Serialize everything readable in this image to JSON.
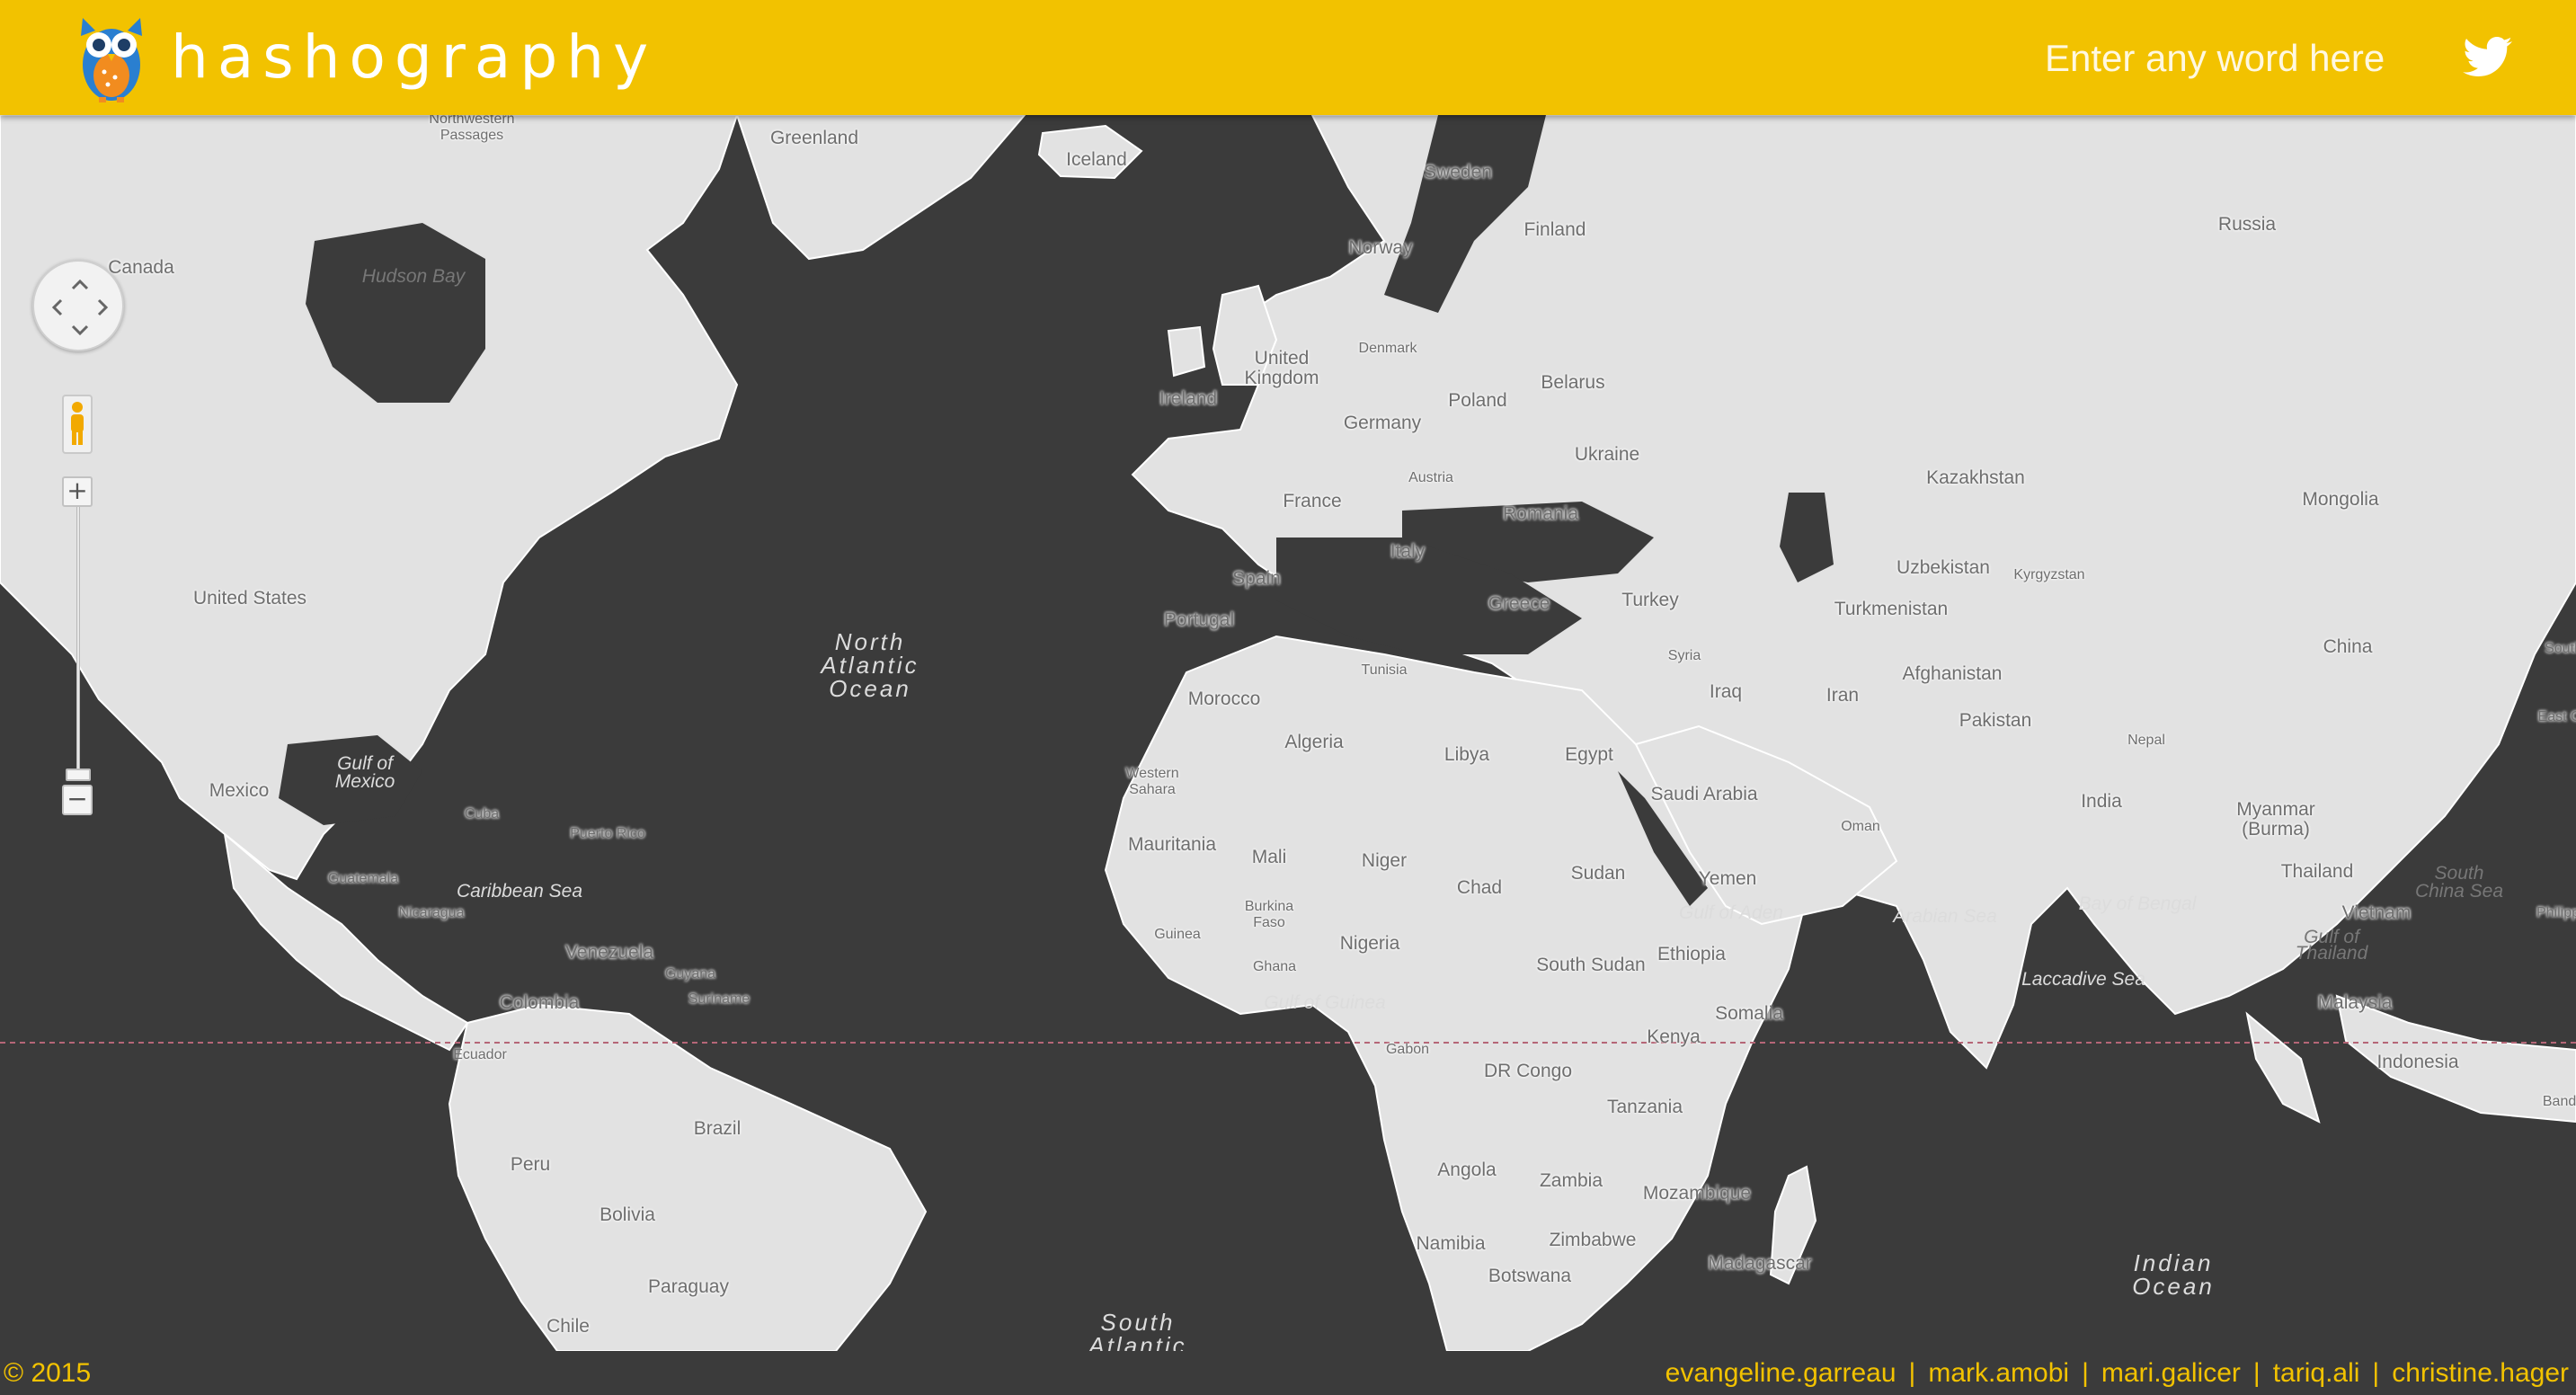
{
  "header": {
    "brand": "hashography",
    "search_placeholder": "Enter any word here",
    "logo_icon": "owl-icon",
    "share_icon": "twitter-icon",
    "brand_color": "#f2c200"
  },
  "map": {
    "controls": {
      "pan_icon": "pan-arrows-icon",
      "pegman_icon": "street-view-pegman-icon",
      "zoom_in": "+",
      "zoom_out": "−"
    },
    "labels": {
      "northwestern_passages": "Northwestern\nPassages",
      "greenland": "Greenland",
      "iceland": "Iceland",
      "sweden": "Sweden",
      "finland": "Finland",
      "norway": "Norway",
      "russia": "Russia",
      "canada": "Canada",
      "hudson_bay": "Hudson Bay",
      "united_kingdom": "United\nKingdom",
      "denmark": "Denmark",
      "ireland": "Ireland",
      "poland": "Poland",
      "belarus": "Belarus",
      "germany": "Germany",
      "ukraine": "Ukraine",
      "kazakhstan": "Kazakhstan",
      "mongolia": "Mongolia",
      "france": "France",
      "austria": "Austria",
      "romania": "Romania",
      "italy": "Italy",
      "united_states": "United States",
      "spain": "Spain",
      "portugal": "Portugal",
      "uzbekistan": "Uzbekistan",
      "kyrgyzstan": "Kyrgyzstan",
      "turkey": "Turkey",
      "greece": "Greece",
      "turkmenistan": "Turkmenistan",
      "north_atlantic_ocean": "North\nAtlantic\nOcean",
      "syria": "Syria",
      "china": "China",
      "tunisia": "Tunisia",
      "afghanistan": "Afghanistan",
      "iraq": "Iraq",
      "iran": "Iran",
      "morocco": "Morocco",
      "pakistan": "Pakistan",
      "gulf_of_mexico": "Gulf of\nMexico",
      "algeria": "Algeria",
      "libya": "Libya",
      "egypt": "Egypt",
      "nepal": "Nepal",
      "western_sahara": "Western\nSahara",
      "mexico": "Mexico",
      "saudi_arabia": "Saudi Arabia",
      "india": "India",
      "cuba": "Cuba",
      "puerto_rico": "Puerto Rico",
      "myanmar": "Myanmar\n(Burma)",
      "oman": "Oman",
      "mauritania": "Mauritania",
      "mali": "Mali",
      "niger": "Niger",
      "sudan": "Sudan",
      "guatemala": "Guatemala",
      "yemen": "Yemen",
      "chad": "Chad",
      "caribbean_sea": "Caribbean Sea",
      "thailand": "Thailand",
      "south_china_sea": "South\nChina Sea",
      "bay_of_bengal": "Bay of Bengal",
      "burkina_faso": "Burkina\nFaso",
      "gulf_of_aden": "Gulf of Aden",
      "arabian_sea": "Arabian Sea",
      "nicaragua": "Nicaragua",
      "vietnam": "Vietnam",
      "venezuela": "Venezuela",
      "guinea": "Guinea",
      "nigeria": "Nigeria",
      "ethiopia": "Ethiopia",
      "gulf_of_thailand": "Gulf of\nThailand",
      "guyana": "Guyana",
      "ghana": "Ghana",
      "south_sudan": "South Sudan",
      "suriname": "Suriname",
      "laccadive_sea": "Laccadive Sea",
      "colombia": "Colombia",
      "gulf_of_guinea": "Gulf of Guinea",
      "somalia": "Somalia",
      "malaysia": "Malaysia",
      "ecuador": "Ecuador",
      "gabon": "Gabon",
      "kenya": "Kenya",
      "indonesia": "Indonesia",
      "dr_congo": "DR Congo",
      "tanzania": "Tanzania",
      "brazil": "Brazil",
      "peru": "Peru",
      "angola": "Angola",
      "zambia": "Zambia",
      "mozambique": "Mozambique",
      "bolivia": "Bolivia",
      "zimbabwe": "Zimbabwe",
      "namibia": "Namibia",
      "madagascar": "Madagascar",
      "indian_ocean": "Indian\nOcean",
      "botswana": "Botswana",
      "paraguay": "Paraguay",
      "chile": "Chile",
      "south_atlantic": "South\nAtlantic",
      "east_china": "East Ch",
      "south_edge": "South",
      "philippines_edge": "Philipp",
      "banda_edge": "Banda"
    }
  },
  "footer": {
    "copyright": "© 2015",
    "credits": [
      "evangeline.garreau",
      "mark.amobi",
      "mari.galicer",
      "tariq.ali",
      "christine.hager"
    ],
    "separator": "|"
  }
}
